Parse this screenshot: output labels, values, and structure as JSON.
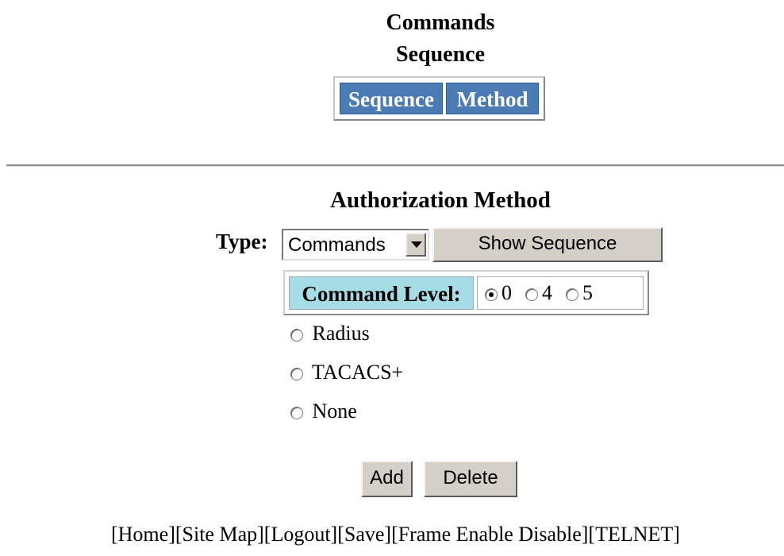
{
  "header": {
    "title_line1": "Commands",
    "title_line2": "Sequence",
    "tabs": [
      {
        "label": "Sequence"
      },
      {
        "label": "Method"
      }
    ],
    "tab_color": "#4b7bb5"
  },
  "form": {
    "section_title": "Authorization Method",
    "type_label": "Type:",
    "type_value": "Commands",
    "show_sequence_label": "Show Sequence",
    "command_level": {
      "label": "Command Level:",
      "label_bg": "#a6dce6",
      "options": [
        "0",
        "4",
        "5"
      ],
      "selected": "0"
    },
    "methods": [
      {
        "label": "Radius",
        "selected": false
      },
      {
        "label": "TACACS+",
        "selected": false
      },
      {
        "label": "None",
        "selected": false
      }
    ],
    "add_label": "Add",
    "delete_label": "Delete"
  },
  "footer": {
    "links": [
      "[Home]",
      "[Site Map]",
      "[Logout]",
      "[Save]",
      "[Frame Enable Disable]",
      "[TELNET]"
    ]
  }
}
